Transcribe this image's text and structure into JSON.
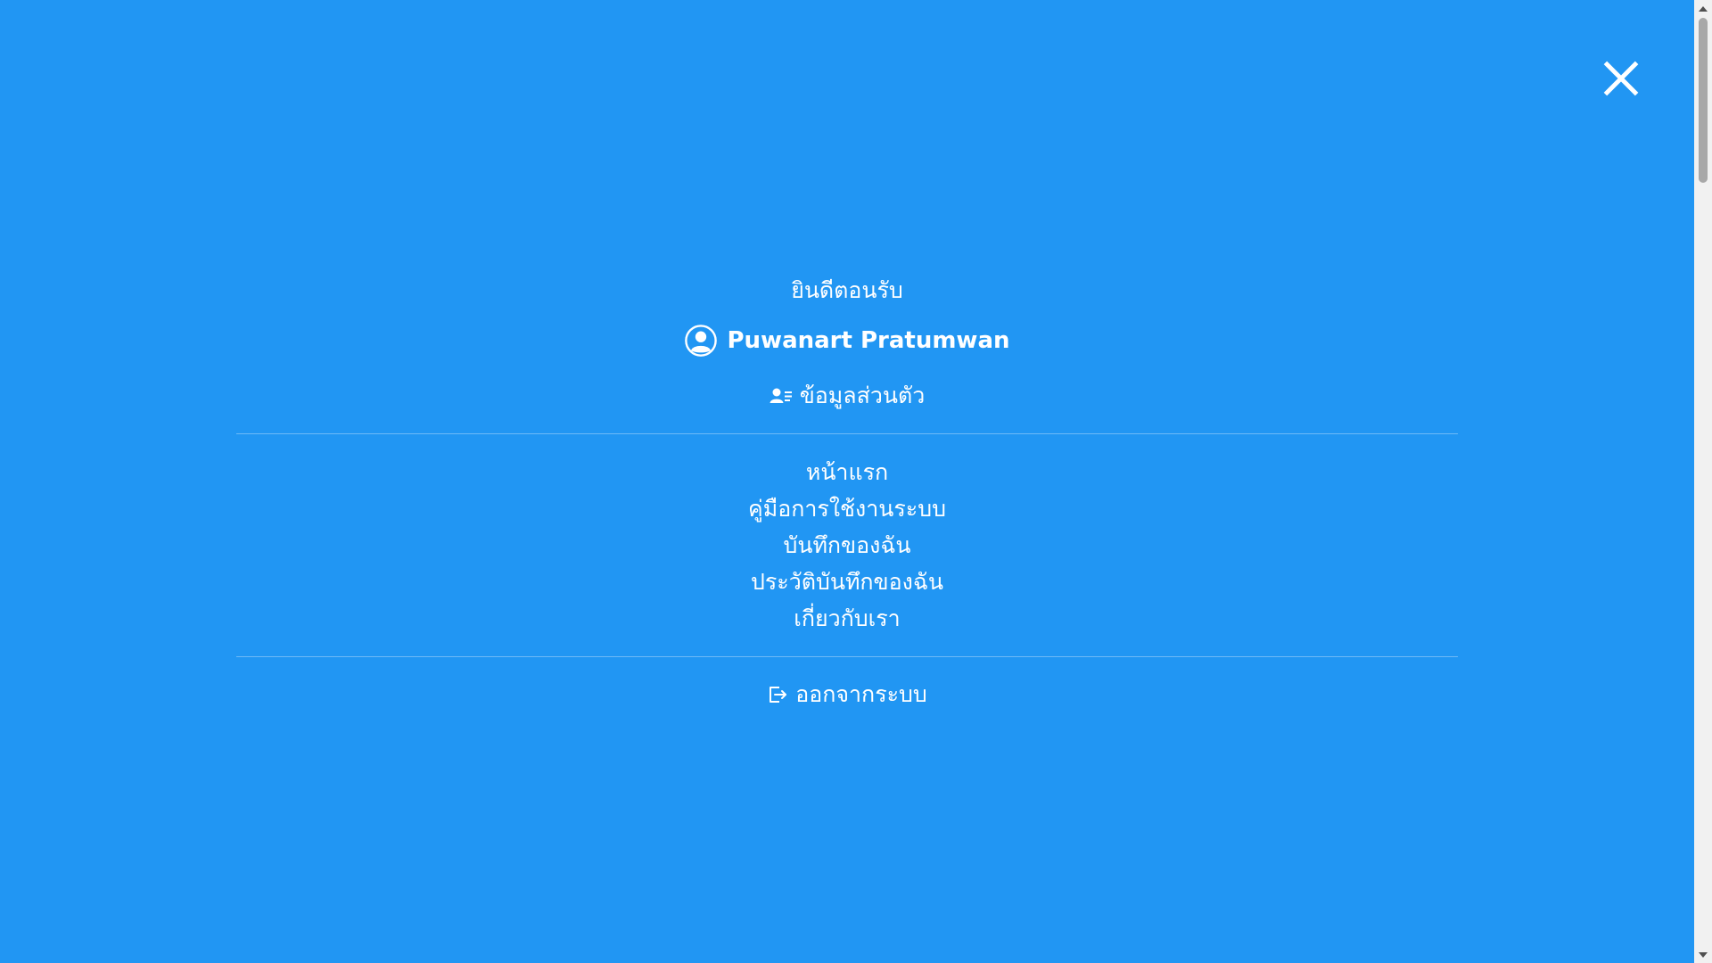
{
  "header": {
    "close_icon": "close-icon"
  },
  "menu": {
    "welcome": "ยินดีตอนรับ",
    "user_name": "Puwanart Pratumwan",
    "profile_label": "ข้อมูลส่วนตัว",
    "nav_items": [
      {
        "label": "หน้าแรก"
      },
      {
        "label": "คู่มือการใช้งานระบบ"
      },
      {
        "label": "บันทึกของฉัน"
      },
      {
        "label": "ประวัติบันทึกของฉัน"
      },
      {
        "label": "เกี่ยวกับเรา"
      }
    ],
    "logout_label": "ออกจากระบบ"
  },
  "colors": {
    "background": "#2196f3",
    "text": "#ffffff"
  }
}
